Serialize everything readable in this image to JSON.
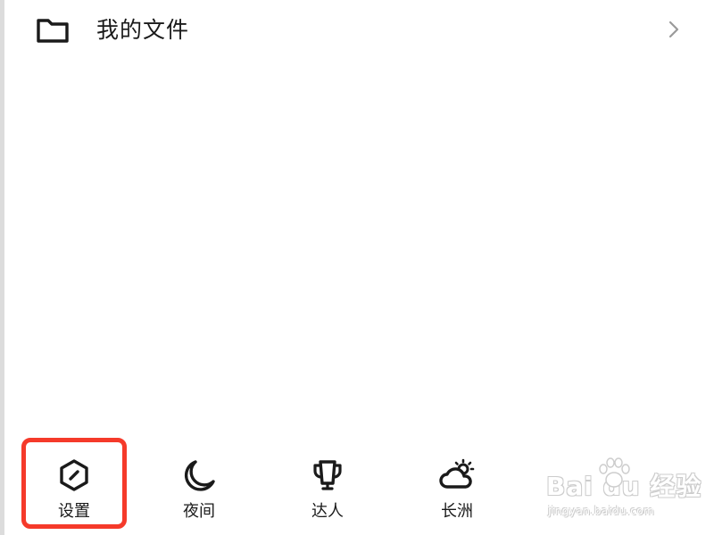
{
  "files_row": {
    "icon": "folder-icon",
    "label": "我的文件",
    "chevron": "chevron-right-icon"
  },
  "bottom_bar": {
    "items": [
      {
        "label": "设置",
        "icon": "hexagon-settings-icon",
        "selected": true
      },
      {
        "label": "夜间",
        "icon": "moon-icon",
        "selected": false
      },
      {
        "label": "达人",
        "icon": "trophy-icon",
        "selected": false
      },
      {
        "label": "长洲",
        "icon": "weather-cloud-sun-icon",
        "selected": false
      }
    ]
  },
  "highlight_color": "#f53a2a",
  "watermark": {
    "logo_text": "Bai du 经验",
    "url": "jingyan.baidu.com"
  }
}
